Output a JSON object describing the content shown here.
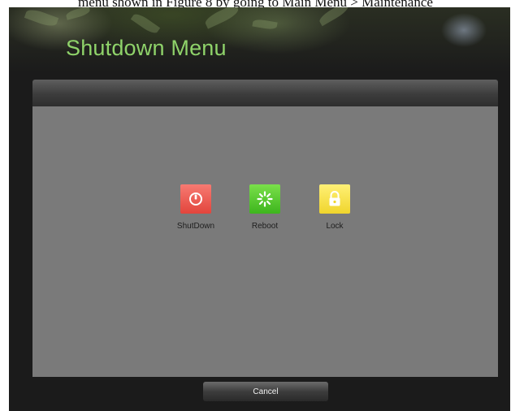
{
  "caption": "menu shown in Figure 8 by going to Main Menu > Maintenance",
  "window": {
    "title": "Shutdown Menu"
  },
  "menu": {
    "items": [
      {
        "label": "ShutDown",
        "icon": "power-icon",
        "color": "#e8524a"
      },
      {
        "label": "Reboot",
        "icon": "reboot-icon",
        "color": "#4fc42a"
      },
      {
        "label": "Lock",
        "icon": "lock-icon",
        "color": "#f5de3f"
      }
    ]
  },
  "footer": {
    "cancel_label": "Cancel"
  },
  "colors": {
    "title": "#8fd36a",
    "panel": "#7a7a7a",
    "background": "#1b1b1b"
  }
}
